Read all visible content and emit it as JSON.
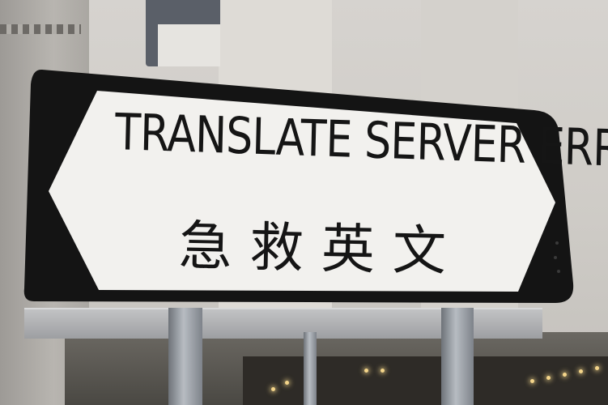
{
  "sign": {
    "english_text": "TRANSLATE SERVER ERROR",
    "chinese_text": "急救英文"
  },
  "colors": {
    "sign_face": "#f2f1ee",
    "sign_border": "#141414",
    "lettering": "#151515",
    "pole": "#9ca1a7",
    "wall": "#cfccc7"
  }
}
